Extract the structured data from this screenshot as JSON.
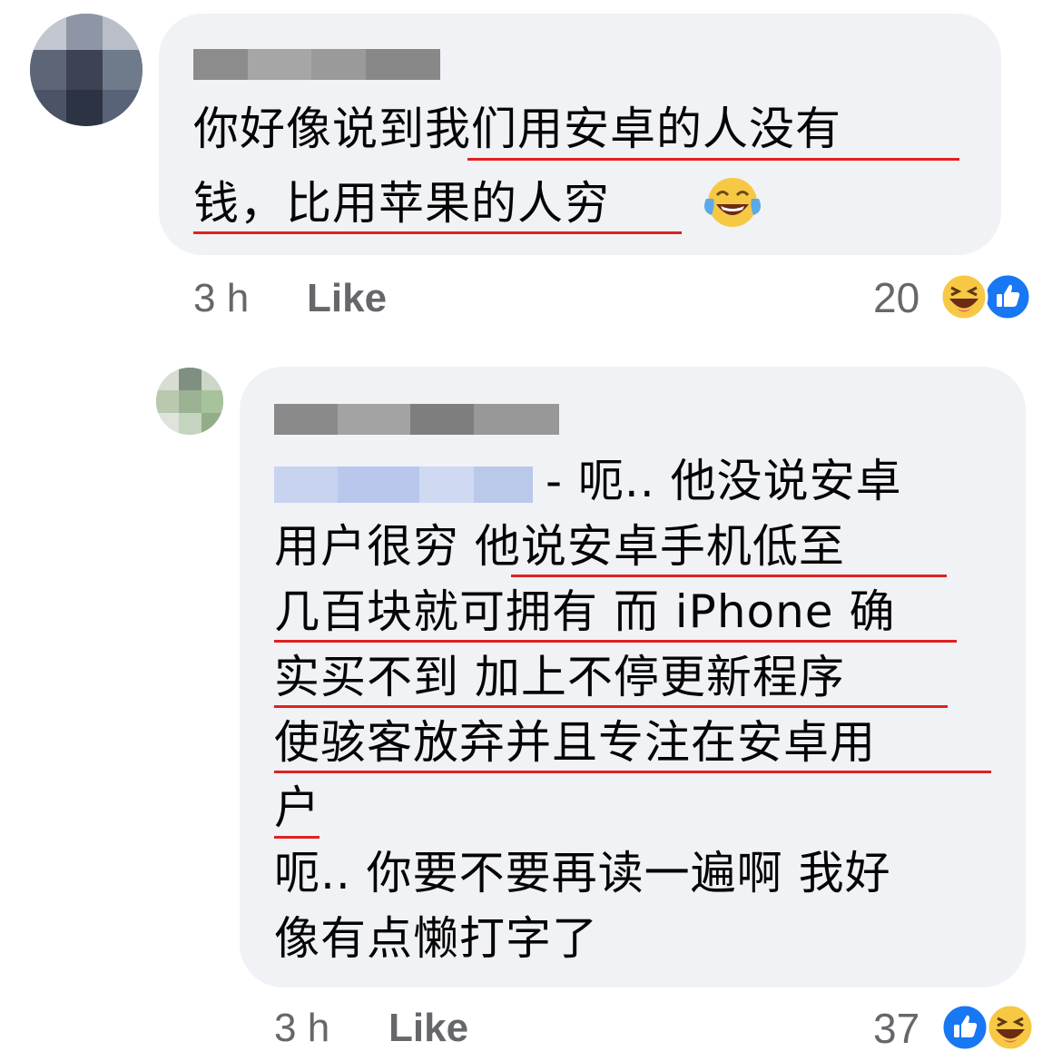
{
  "comments": [
    {
      "author_blurred": true,
      "text_lines": [
        "你好像说到我们用安卓的人没有",
        "钱，比用苹果的人穷"
      ],
      "emoji": "laughing-tears-emoji",
      "time": "3 h",
      "like_label": "Like",
      "reaction_count": "20",
      "reactions": [
        "haha-icon",
        "like-icon"
      ]
    },
    {
      "author_blurred": true,
      "mention_blurred": true,
      "text_lines": [
        "- 呃.. 他没说安卓",
        "用户很穷 他说安卓手机低至",
        "几百块就可拥有 而 iPhone 确",
        "实买不到 加上不停更新程序",
        "使骇客放弃并且专注在安卓用",
        "户",
        "呃.. 你要不要再读一遍啊 我好",
        "像有点懒打字了"
      ],
      "time": "3 h",
      "like_label": "Like",
      "reaction_count": "37",
      "reactions": [
        "like-icon",
        "haha-icon"
      ]
    }
  ],
  "colors": {
    "bubble": "#f0f2f5",
    "underline": "#e02020",
    "meta": "#65676b",
    "like_blue": "#1877f2",
    "haha_yellow": "#f7c844"
  }
}
